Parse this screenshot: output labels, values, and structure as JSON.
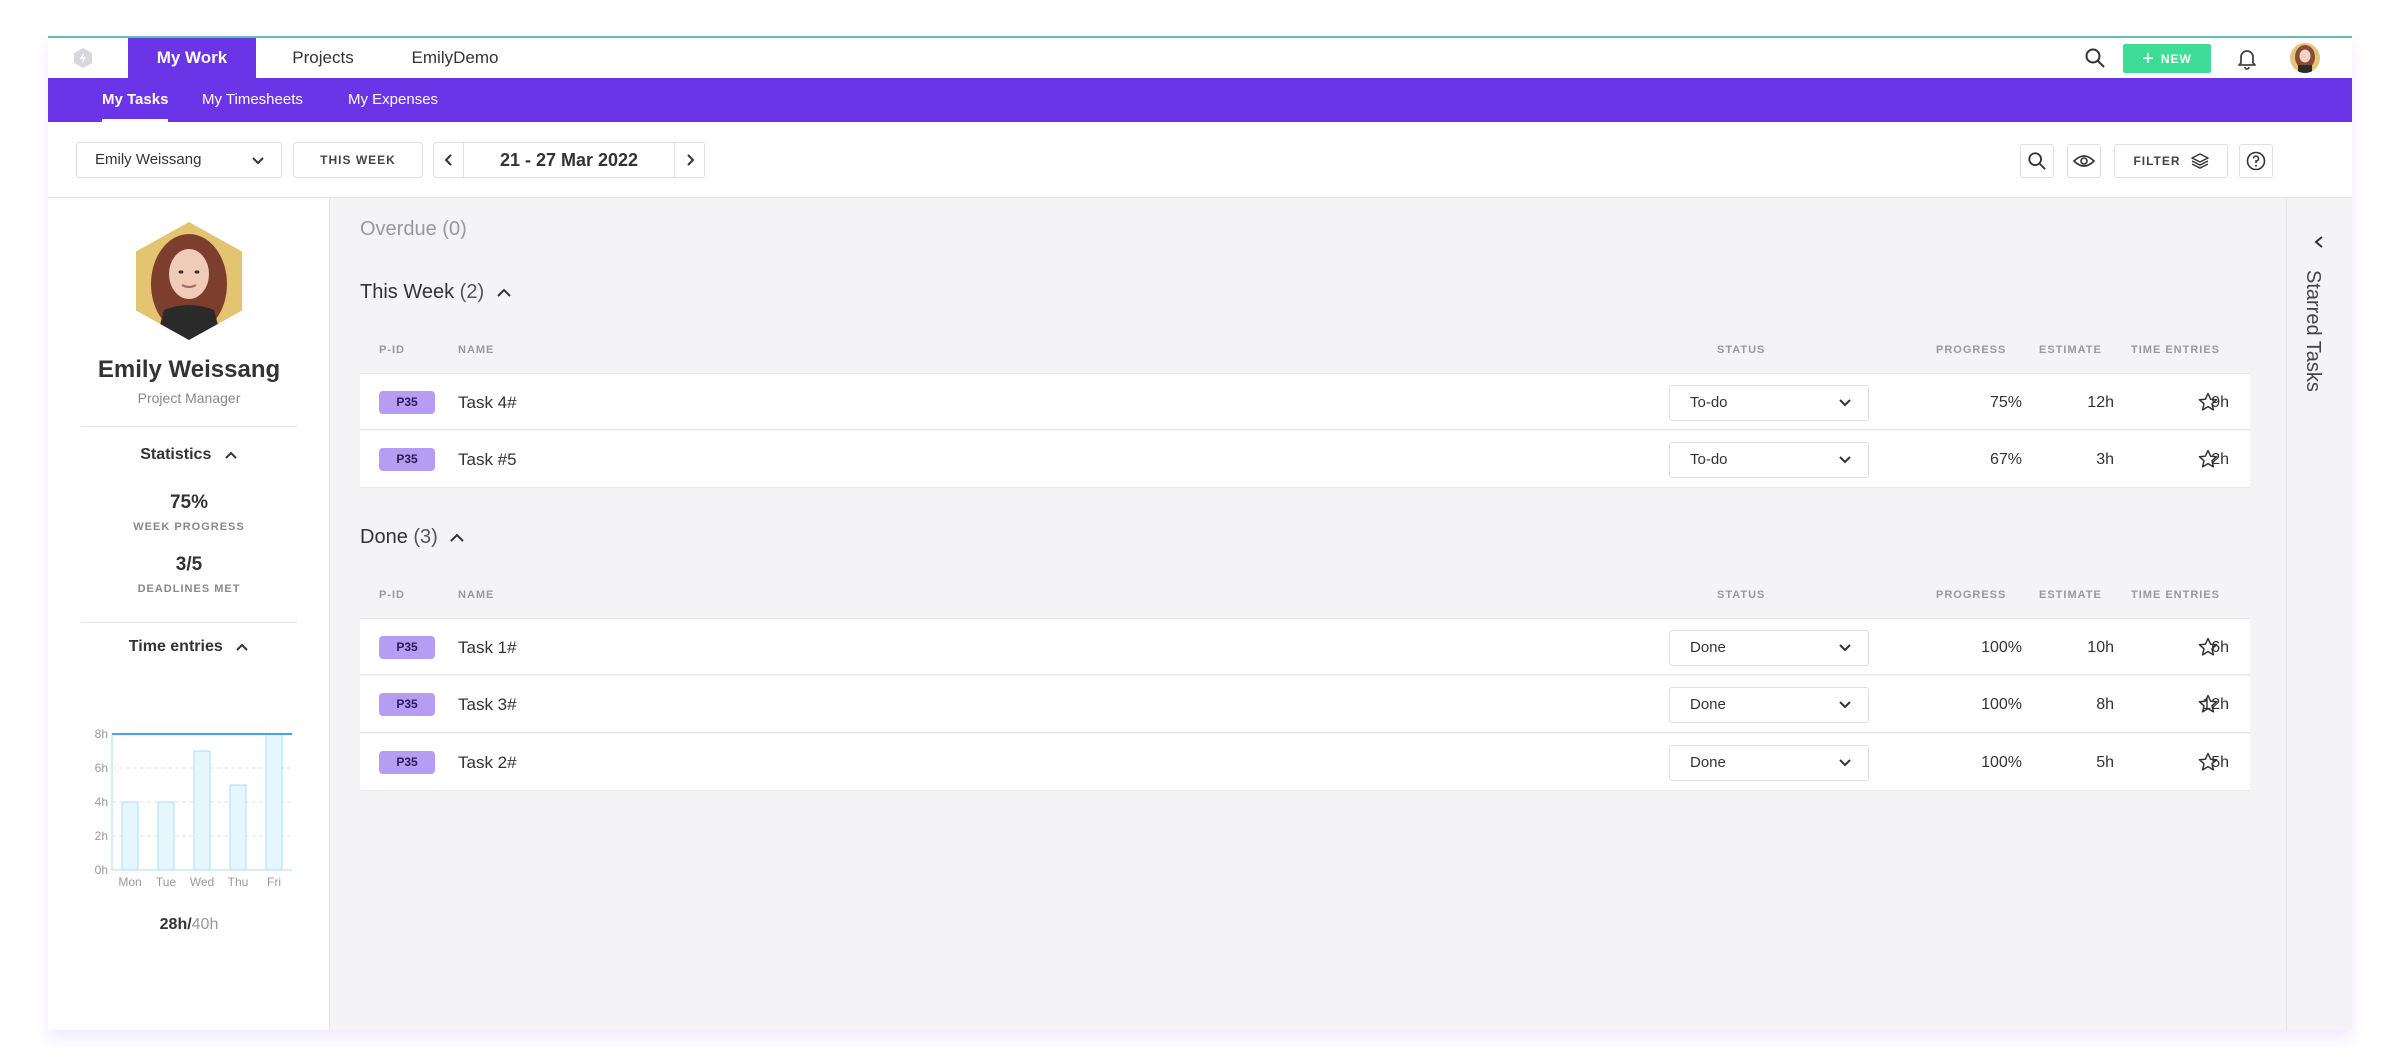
{
  "nav": {
    "tabs": [
      {
        "label": "My Work",
        "active": true
      },
      {
        "label": "Projects",
        "active": false
      },
      {
        "label": "EmilyDemo",
        "active": false
      }
    ],
    "new_label": "NEW"
  },
  "subnav": {
    "tabs": [
      {
        "label": "My Tasks",
        "active": true
      },
      {
        "label": "My Timesheets",
        "active": false
      },
      {
        "label": "My Expenses",
        "active": false
      }
    ]
  },
  "toolbar": {
    "user_select": "Emily Weissang",
    "this_week_label": "THIS WEEK",
    "date_range": "21 - 27 Mar 2022",
    "filter_label": "FILTER"
  },
  "profile": {
    "name": "Emily Weissang",
    "role": "Project Manager",
    "statistics_title": "Statistics",
    "week_progress_value": "75%",
    "week_progress_label": "WEEK PROGRESS",
    "deadlines_value": "3/5",
    "deadlines_label": "DEADLINES MET",
    "time_entries_title": "Time entries",
    "total_logged": "28h/",
    "total_capacity": "40h"
  },
  "chart_data": {
    "type": "bar",
    "categories": [
      "Mon",
      "Tue",
      "Wed",
      "Thu",
      "Fri"
    ],
    "values": [
      4,
      4,
      7,
      5,
      8
    ],
    "y_ticks": [
      "0h",
      "2h",
      "4h",
      "6h",
      "8h"
    ],
    "ylim": [
      0,
      8
    ],
    "capacity_line": 8,
    "colors": {
      "bar_fill": "#e6f6fd",
      "bar_stroke": "#a8def5",
      "capacity": "#3fa9e0"
    }
  },
  "columns": {
    "pid": "P-ID",
    "name": "NAME",
    "status": "STATUS",
    "progress": "PROGRESS",
    "estimate": "ESTIMATE",
    "time_entries": "TIME ENTRIES"
  },
  "groups": {
    "overdue": {
      "title": "Overdue",
      "count": "(0)"
    },
    "this_week": {
      "title": "This Week",
      "count": "(2)",
      "rows": [
        {
          "pid": "P35",
          "name": "Task 4#",
          "status": "To-do",
          "progress": "75%",
          "estimate": "12h",
          "time": "9h"
        },
        {
          "pid": "P35",
          "name": "Task #5",
          "status": "To-do",
          "progress": "67%",
          "estimate": "3h",
          "time": "2h"
        }
      ]
    },
    "done": {
      "title": "Done",
      "count": "(3)",
      "rows": [
        {
          "pid": "P35",
          "name": "Task 1#",
          "status": "Done",
          "progress": "100%",
          "estimate": "10h",
          "time": "6h"
        },
        {
          "pid": "P35",
          "name": "Task 3#",
          "status": "Done",
          "progress": "100%",
          "estimate": "8h",
          "time": "12h"
        },
        {
          "pid": "P35",
          "name": "Task 2#",
          "status": "Done",
          "progress": "100%",
          "estimate": "5h",
          "time": "5h"
        }
      ]
    }
  },
  "starred_panel": {
    "label": "Starred Tasks"
  },
  "colors": {
    "brand": "#6c34e7",
    "new_button": "#3ddc97",
    "pid_badge": "#b79cf3"
  }
}
